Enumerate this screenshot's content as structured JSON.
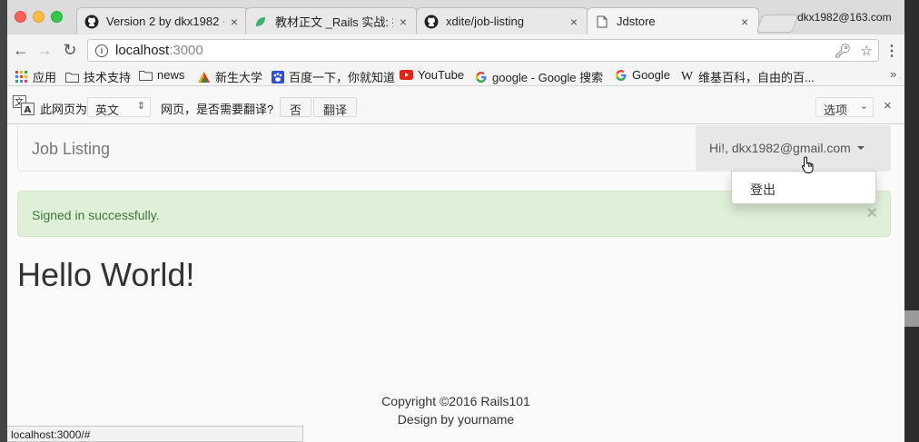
{
  "browser": {
    "tabs": [
      {
        "title": "Version 2 by dkx1982 ·",
        "icon": "github-icon",
        "active": false
      },
      {
        "title": "教材正文 _Rails 实战: 招",
        "icon": "leaf-icon",
        "active": false
      },
      {
        "title": "xdite/job-listing",
        "icon": "github-icon",
        "active": false
      },
      {
        "title": "Jdstore",
        "icon": "page-icon",
        "active": true
      }
    ],
    "tab_close": "×",
    "profile": "dkx1982@163.com",
    "url_host": "localhost",
    "url_port": ":3000",
    "bookmarks": [
      {
        "label": "应用",
        "icon": "apps-icon"
      },
      {
        "label": "技术支持",
        "icon": "folder-icon"
      },
      {
        "label": "news",
        "icon": "folder-icon"
      },
      {
        "label": "新生大学",
        "icon": "triangle-icon"
      },
      {
        "label": "百度一下，你就知道",
        "icon": "baidu-icon"
      },
      {
        "label": "YouTube",
        "icon": "youtube-icon"
      },
      {
        "label": "google - Google 搜索",
        "icon": "google-icon"
      },
      {
        "label": "Google",
        "icon": "google-icon"
      },
      {
        "label": "维基百科，自由的百...",
        "icon": "wikipedia-icon"
      }
    ],
    "bookmarks_more": "»",
    "translate": {
      "prefix": "此网页为",
      "language": "英文",
      "question": "网页，是否需要翻译?",
      "no_button": "否",
      "translate_button": "翻译",
      "options": "选项",
      "close": "×"
    },
    "status_url": "localhost:3000/#"
  },
  "page": {
    "brand": "Job Listing",
    "user_menu": "Hi!, dkx1982@gmail.com",
    "dropdown_items": [
      "登出"
    ],
    "alert": "Signed in successfully.",
    "alert_close": "×",
    "heading": "Hello World!",
    "footer_line1": "Copyright ©2016 Rails101",
    "footer_line2": "Design by yourname"
  },
  "colors": {
    "alert_bg": "#dff0d8",
    "alert_text": "#3c763d",
    "navbar_bg": "#f8f8f8",
    "youtube_red": "#e62117"
  }
}
